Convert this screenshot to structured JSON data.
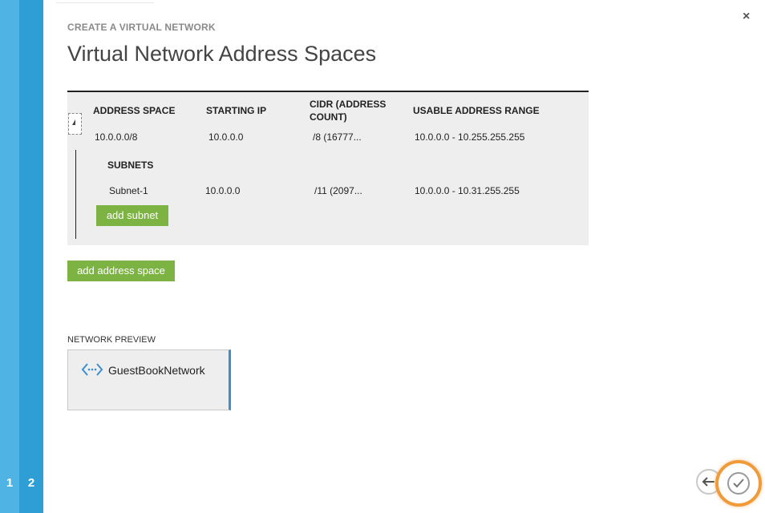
{
  "wizard": {
    "steps": [
      "1",
      "2"
    ],
    "step_label": "CREATE A VIRTUAL NETWORK",
    "title": "Virtual Network Address Spaces"
  },
  "address_table": {
    "headers": {
      "address_space": "ADDRESS SPACE",
      "starting_ip": "STARTING IP",
      "cidr_line1": "CIDR (ADDRESS",
      "cidr_line2": "COUNT)",
      "usable_range": "USABLE ADDRESS RANGE"
    },
    "rows": [
      {
        "address_space": "10.0.0.0/8",
        "starting_ip": "10.0.0.0",
        "cidr": "/8 (16777...",
        "usable_range": "10.0.0.0 - 10.255.255.255"
      }
    ],
    "subnets_heading": "SUBNETS",
    "subnets": [
      {
        "name": "Subnet-1",
        "starting_ip": "10.0.0.0",
        "cidr": "/11 (2097...",
        "usable_range": "10.0.0.0 - 10.31.255.255"
      }
    ],
    "add_subnet_label": "add subnet"
  },
  "add_address_space_label": "add address space",
  "preview": {
    "label": "NETWORK PREVIEW",
    "network_name": "GuestBookNetwork",
    "icon": "virtual-network-icon"
  },
  "navigation": {
    "close_glyph": "×",
    "back_icon": "back-arrow-icon",
    "finish_icon": "checkmark-icon"
  },
  "colors": {
    "rail_light": "#4fb3e3",
    "rail_dark": "#2f9ed4",
    "button_green": "#7cb342",
    "accent_blue": "#3b8fd0",
    "finish_orange": "#f09a3a"
  }
}
